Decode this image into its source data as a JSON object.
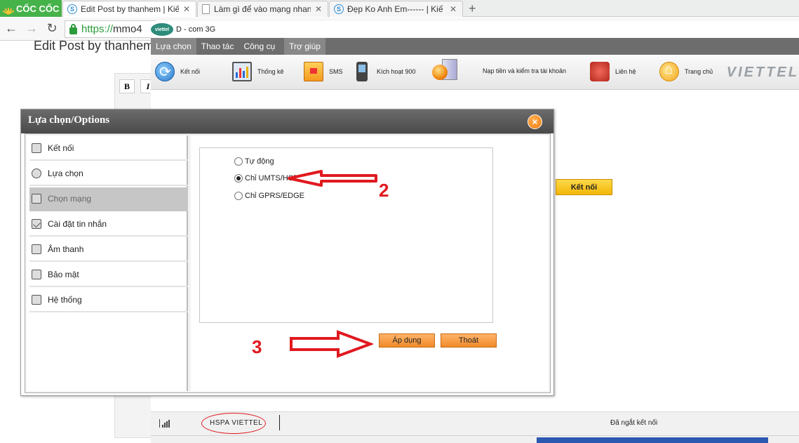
{
  "browser": {
    "brand": "CỐC CỐC",
    "tabs": [
      {
        "label": "Edit Post by thanhem | Kiế"
      },
      {
        "label": "Làm gì để vào mạng nhanh"
      },
      {
        "label": "Đẹp Ko Anh Em------ | Kiế"
      }
    ],
    "url_scheme": "https://",
    "url_host": "mmo4"
  },
  "background_page": {
    "title": "Edit Post by thanhem",
    "bold_btn": "B",
    "italic_btn": "I"
  },
  "app": {
    "logo_text": "viettel",
    "title": "D - com 3G",
    "menu": [
      "Lựa chọn",
      "Thao tác",
      "Công cụ",
      "Trợ giúp"
    ],
    "toolbar": [
      {
        "label": "Kết nối",
        "icon": "connect-icon"
      },
      {
        "label": "Thống kê",
        "icon": "statistics-icon"
      },
      {
        "label": "SMS",
        "icon": "sms-icon"
      },
      {
        "label": "Kích hoạt 900",
        "icon": "phone-icon"
      },
      {
        "label": "Nạp tiền và kiểm tra tài khoản",
        "icon": "topup-icon"
      },
      {
        "label": "Liên hệ",
        "icon": "telephone-icon"
      },
      {
        "label": "Trang chủ",
        "icon": "home-icon"
      }
    ],
    "brand_watermark": "VIETTEL",
    "connect_button": "Kết nối",
    "status": {
      "network": "HSPA  VIETTEL",
      "connection": "Đã ngắt kết nối"
    }
  },
  "dialog": {
    "title": "Lựa chọn/Options",
    "close": "×",
    "sidebar": [
      {
        "label": "Kết nối",
        "active": false
      },
      {
        "label": "Lựa chọn",
        "active": false
      },
      {
        "label": "Chọn mạng",
        "active": true
      },
      {
        "label": "Cài đặt tin nhắn",
        "active": false
      },
      {
        "label": "Âm thanh",
        "active": false
      },
      {
        "label": "Bảo mật",
        "active": false
      },
      {
        "label": "Hệ thống",
        "active": false
      }
    ],
    "options": [
      {
        "label": "Tự động",
        "checked": false
      },
      {
        "label": "Chỉ UMTS/HSPA",
        "checked": true
      },
      {
        "label": "Chỉ GPRS/EDGE",
        "checked": false
      }
    ],
    "apply_button": "Áp dụng",
    "exit_button": "Thoát"
  },
  "annotations": {
    "step2": "2",
    "step3": "3",
    "color": "#e0191f"
  },
  "colors": {
    "menubar": "#6d6d6d",
    "dialog_title": "#4a4a4a",
    "orange_button": "#f08a2a",
    "yellow_button": "#f2b705",
    "brand_green": "#46b24a"
  }
}
